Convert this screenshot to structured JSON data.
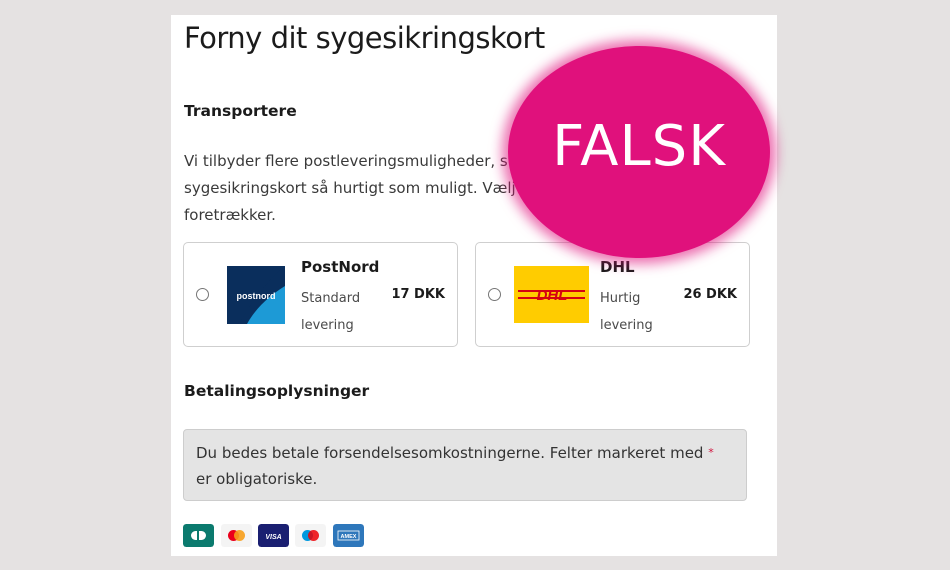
{
  "page": {
    "title": "Forny dit sygesikringskort"
  },
  "transport": {
    "heading": "Transportere",
    "intro_lines": [
      "Vi tilbyder flere postleveringsmuligheder, s",
      "sygesikringskort så hurtigt som muligt. Vælj",
      "foretrækker."
    ],
    "carriers": [
      {
        "name": "PostNord",
        "desc_lines": [
          "Standard",
          "levering"
        ],
        "price": "17 DKK",
        "logo_text": "postnord",
        "logo_colors": {
          "dark": "#0a2e5c",
          "light": "#1d9ad6",
          "text": "#ffffff"
        },
        "selected": false
      },
      {
        "name": "DHL",
        "desc_lines": [
          "Hurtig",
          "levering"
        ],
        "price": "26 DKK",
        "logo_text": "DHL",
        "logo_colors": {
          "bg": "#ffcc00",
          "text": "#d40511"
        },
        "selected": false
      }
    ]
  },
  "payment": {
    "heading": "Betalingsoplysninger",
    "notice_text": "Du bedes betale forsendelsesomkostningerne. Felter markeret med",
    "notice_required_marker": "*",
    "notice_text_2": "er obligatoriske.",
    "cards": [
      {
        "name": "dankort-icon",
        "label": "",
        "bg": "#0b7a6e"
      },
      {
        "name": "mastercard-icon",
        "label": "",
        "bg": "#f4f4f4"
      },
      {
        "name": "visa-icon",
        "label": "VISA",
        "bg": "#1a1f71"
      },
      {
        "name": "maestro-icon",
        "label": "",
        "bg": "#f4f4f4"
      },
      {
        "name": "amex-icon",
        "label": "AMEX",
        "bg": "#2e77bb"
      }
    ]
  },
  "overlay": {
    "stamp_text": "FALSK",
    "stamp_color": "#e0117c"
  }
}
